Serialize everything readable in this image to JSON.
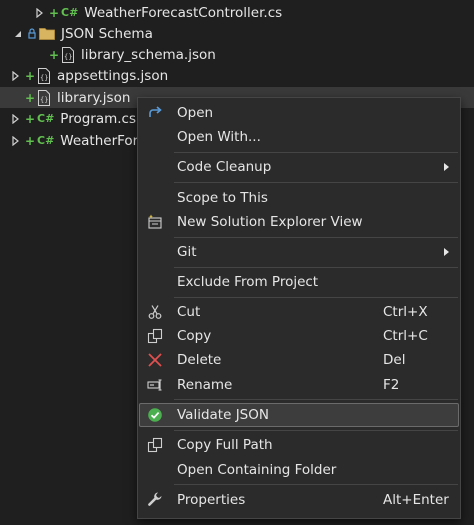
{
  "tree": {
    "items": [
      {
        "label": "WeatherForecastController.cs"
      },
      {
        "label": "JSON Schema"
      },
      {
        "label": "library_schema.json"
      },
      {
        "label": "appsettings.json"
      },
      {
        "label": "library.json"
      },
      {
        "label": "Program.cs"
      },
      {
        "label": "WeatherForec"
      }
    ],
    "cs_badge": "C#"
  },
  "menu": {
    "open": "Open",
    "open_with": "Open With...",
    "code_cleanup": "Code Cleanup",
    "scope_to_this": "Scope to This",
    "new_solution_explorer_view": "New Solution Explorer View",
    "git": "Git",
    "exclude_from_project": "Exclude From Project",
    "cut": "Cut",
    "cut_shortcut": "Ctrl+X",
    "copy": "Copy",
    "copy_shortcut": "Ctrl+C",
    "delete": "Delete",
    "delete_shortcut": "Del",
    "rename": "Rename",
    "rename_shortcut": "F2",
    "validate_json": "Validate JSON",
    "copy_full_path": "Copy Full Path",
    "open_containing_folder": "Open Containing Folder",
    "properties": "Properties",
    "properties_shortcut": "Alt+Enter"
  },
  "colors": {
    "background": "#1f1f1f",
    "menu_background": "#2b2b2b",
    "git_added": "#62c050",
    "delete_red": "#e05050",
    "accent_blue": "#5a9bd8"
  }
}
